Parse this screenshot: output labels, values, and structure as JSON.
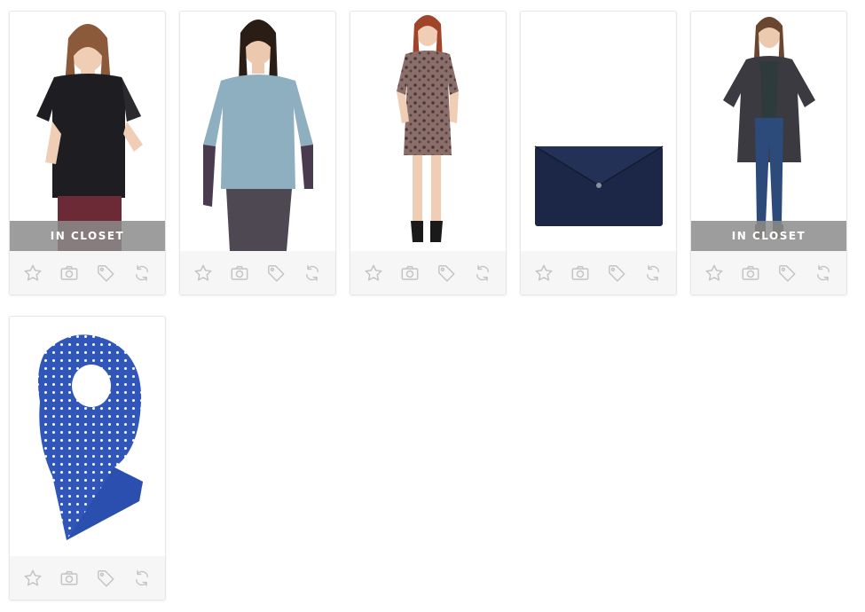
{
  "closet_badge_label": "IN CLOSET",
  "items": [
    {
      "image_icon": "black-tee-model-photo",
      "in_closet": true
    },
    {
      "image_icon": "blue-dolman-top-model-photo",
      "in_closet": false
    },
    {
      "image_icon": "leopard-dress-model-photo",
      "in_closet": false
    },
    {
      "image_icon": "navy-envelope-clutch-photo",
      "in_closet": false
    },
    {
      "image_icon": "gray-coat-model-photo",
      "in_closet": true
    },
    {
      "image_icon": "blue-polka-dot-scarf-photo",
      "in_closet": false
    }
  ],
  "action_icons": [
    "star-icon",
    "camera-icon",
    "tag-icon",
    "refresh-icon"
  ],
  "colors": {
    "badge_bg": "#8c8c8c",
    "action_bar_bg": "#f6f6f6",
    "action_icon": "#c4c4c4",
    "card_border": "#e6e6e6"
  }
}
